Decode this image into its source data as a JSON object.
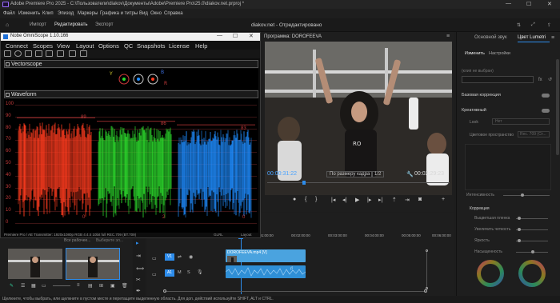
{
  "app": {
    "title": "Adobe Premiere Pro 2025 - C:\\Пользователи\\diakov\\Документы\\Adobe\\Premiere Pro\\25.0\\diakov.net.prproj *",
    "window_controls": {
      "minimize": "—",
      "maximize": "☐",
      "close": "✕"
    }
  },
  "menu": [
    "Файл",
    "Изменить",
    "Клип",
    "Эпизод",
    "Маркеры",
    "Графика и титры",
    "Вид",
    "Окно",
    "Справка"
  ],
  "nav": {
    "tabs": [
      "Импорт",
      "Редактировать",
      "Экспорт"
    ],
    "active_tab": "Редактировать",
    "center": "diakov.net - Отредактировано"
  },
  "omniscope": {
    "title": "Nobe OmniScope 1.10.166",
    "menu": [
      "Connect",
      "Scopes",
      "View",
      "Layout",
      "Options",
      "QC",
      "Snapshots",
      "License",
      "Help"
    ],
    "vectorscope_label": "Vectorscope",
    "waveform_label": "Waveform",
    "vectorscope_marks": [
      "Y",
      "R",
      "B"
    ],
    "grid_labels": [
      "100",
      "90",
      "80",
      "70",
      "60",
      "50",
      "40",
      "30",
      "20",
      "10",
      "0"
    ],
    "channel_peaks": {
      "red": "89",
      "green": "86",
      "blue": "83"
    },
    "channel_lows": {
      "red": "0",
      "green": "2",
      "blue": "0"
    },
    "status_left": "Premiere Pro / AE Transmitter: 1920x1080p RGB 4:4:4 10bit full REC.709 (BT.709)",
    "status_right": "GLRL",
    "status_layout": "Layout",
    "colors": {
      "red": "#ff3b1e",
      "green": "#2cdc2c",
      "blue": "#1e8cff",
      "grid": "#c43a3a"
    }
  },
  "program": {
    "title": "Программа: DOROFEEVA",
    "current_time": "00:00:31:22",
    "fit": "По размеру кадра",
    "resolution": "1/2",
    "duration": "00:02:29:23",
    "accent": "#2d8ceb"
  },
  "lumetri": {
    "tabs": [
      "Основной звук",
      "Цвет Lumetri"
    ],
    "subtabs": [
      "Изменить",
      "Настройки"
    ],
    "clip_placeholder": "(клип не выбран)",
    "fx_label": "fx",
    "sections": [
      "Базовая коррекция",
      "Креативный"
    ],
    "look_label": "Look",
    "look_value": "Нет",
    "color_space_label": "Цветовое пространство",
    "color_space_value": "Rec. 709 (Ст...",
    "intensity_label": "Интенсивность",
    "correction_label": "Коррекция",
    "correction_rows": [
      "Выцветшая пленка",
      "Увеличить четкость",
      "Яркость",
      "Насыщенность"
    ]
  },
  "project": {
    "tab": "Все рабочее...",
    "search_placeholder": "Выберите эл..."
  },
  "timeline": {
    "ruler": [
      "00:00",
      "00:01:00:00",
      "00:02:00:00",
      "00:03:00:00",
      "00:04:00:00",
      "00:05:00:00",
      "00:06:00:00"
    ],
    "tracks": [
      "V1",
      "A1"
    ],
    "video_clip": "DOROFEEVA.mp4 [V]",
    "clip_color": "#4aa3df"
  },
  "statusbar": "Щелкните, чтобы выбрать, или щелкните в пустом месте и перетащите выделенную область. Для доп. действий используйте SHIFT, ALT и CTRL."
}
